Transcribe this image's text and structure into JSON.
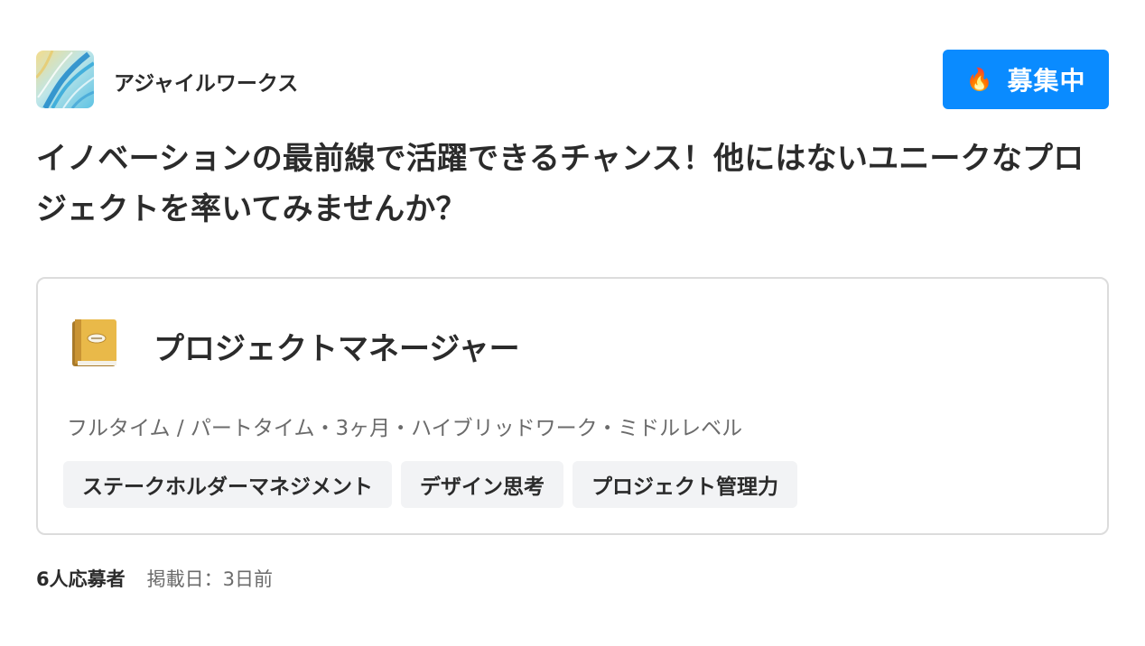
{
  "company": {
    "name": "アジャイルワークス",
    "logo_icon": "abstract-wave-logo"
  },
  "status_badge": {
    "icon": "fire-icon",
    "label": "募集中",
    "color": "#0a8bff"
  },
  "headline": "イノベーションの最前線で活躍できるチャンス！他にはないユニークなプロジェクトを率いてみませんか？",
  "job": {
    "icon": "notebook-icon",
    "title": "プロジェクトマネージャー",
    "meta": "フルタイム / パートタイム・3ヶ月・ハイブリッドワーク・ミドルレベル",
    "tags": [
      "ステークホルダーマネジメント",
      "デザイン思考",
      "プロジェクト管理力"
    ]
  },
  "footer": {
    "applicants": "6人応募者",
    "posted": "掲載日：3日前"
  }
}
